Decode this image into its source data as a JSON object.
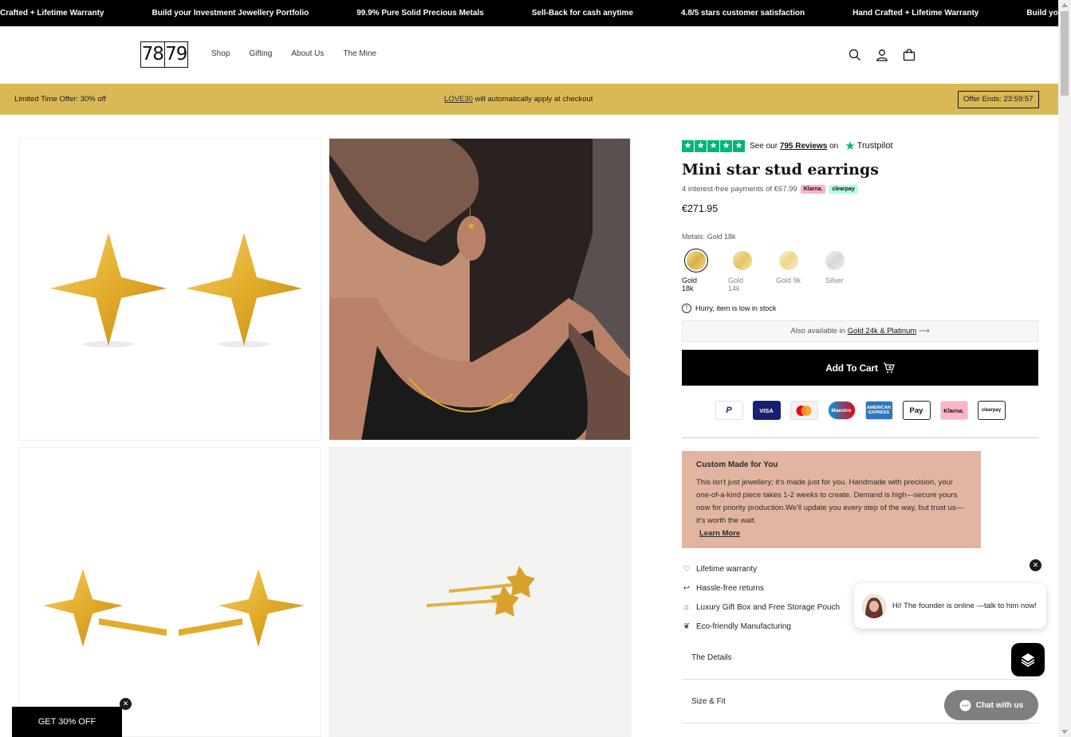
{
  "announcement": {
    "items": [
      "Crafted + Lifetime Warranty",
      "Build your Investment Jewellery Portfolio",
      "99.9% Pure Solid Precious Metals",
      "Sell-Back for cash anytime",
      "4.8/5 stars customer satisfaction",
      "Hand Crafted + Lifetime Warranty",
      "Build your Inve"
    ]
  },
  "header": {
    "logo_left": "78",
    "logo_right": "79",
    "nav": [
      "Shop",
      "Gifting",
      "About Us",
      "The Mine"
    ],
    "icons": [
      "search-icon",
      "account-icon",
      "cart-icon"
    ]
  },
  "promo": {
    "offer": "Limited Time Offer: 30% off",
    "code": "LOVE30",
    "code_suffix": " will automatically apply at checkout",
    "timer": "Offer Ends: 23:59:57"
  },
  "product": {
    "trustpilot_prefix": "See our ",
    "trustpilot_reviews": "795 Reviews",
    "trustpilot_suffix": " on",
    "trustpilot_brand": "Trustpilot",
    "title": "Mini star stud earrings",
    "installments": "4 interest-free payments of €67.99",
    "klarna": "Klarna.",
    "clearpay": "clearpay",
    "price": "€271.95",
    "metals_label": "Metals:",
    "metals_selected": "Gold 18k",
    "metals": [
      {
        "label": "Gold 18k",
        "color": "#e3c66d"
      },
      {
        "label": "Gold 14k",
        "color": "#ead28a"
      },
      {
        "label": "Gold 9k",
        "color": "#f1e0a6"
      },
      {
        "label": "Silver",
        "color": "#e2e2e2"
      }
    ],
    "stock_note": "Hurry, item is low in stock",
    "also_prefix": "Also available in ",
    "also_link": "Gold 24k & Platinum",
    "add_to_cart": "Add To Cart",
    "payments": [
      "PayPal",
      "VISA",
      "Mastercard",
      "Maestro",
      "American Express",
      "Apple Pay",
      "Klarna.",
      "clearpay"
    ],
    "custom_title": "Custom Made for You",
    "custom_text": "This isn't just jewellery; it's made just for you. Handmade with precision, your one-of-a-kind piece takes 1-2 weeks to create. Demand is high—secure yours now for priority production.We'll update you every step of the way, but trust us—it's worth the wait.",
    "custom_link": "Learn More",
    "perks": [
      {
        "icon": "heart-icon",
        "label": "Lifetime warranty"
      },
      {
        "icon": "return-icon",
        "label": "Hassle-free returns"
      },
      {
        "icon": "gift-icon",
        "label": "Luxury Gift Box and Free Storage Pouch"
      },
      {
        "icon": "leaf-icon",
        "label": "Eco-friendly Manufacturing"
      }
    ],
    "accordions": [
      "The Details",
      "Size & Fit"
    ]
  },
  "chat": {
    "popup_text": "Hi! The founder is online —talk to him now!",
    "button_label": "Chat with us"
  },
  "discount_tab": "GET 30% OFF",
  "colors": {
    "promo_bg": "#d9b856",
    "custom_bg": "#e2b5a2",
    "trustpilot": "#00b67a"
  }
}
